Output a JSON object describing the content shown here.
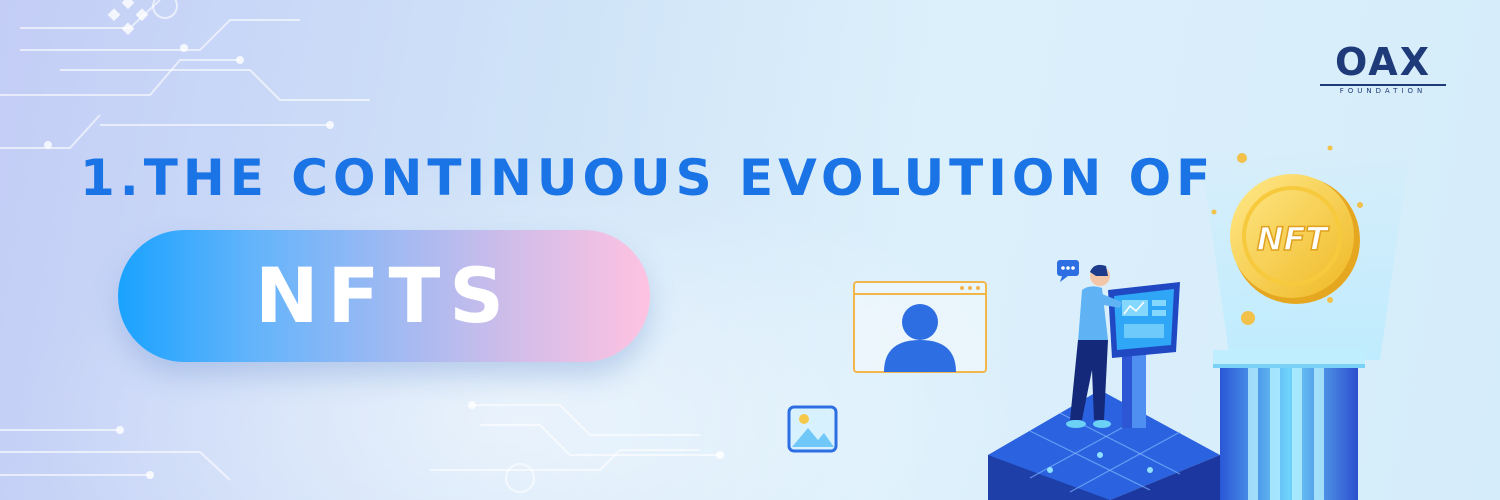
{
  "brand": {
    "logo_text": "OAX",
    "logo_subtext": "FOUNDATION"
  },
  "headline": {
    "line1": "1.THE CONTINUOUS EVOLUTION OF",
    "highlight": "NFTS"
  },
  "illustration": {
    "coin_label": "NFT",
    "icons": [
      "chat-icon",
      "image-icon",
      "user-profile-icon",
      "dashboard-kiosk-icon",
      "nft-coin-icon"
    ]
  },
  "colors": {
    "headline": "#1b74e6",
    "logo": "#1e3a78",
    "pill_start": "#1aa2ff",
    "pill_end": "#ffc2e1",
    "coin": "#f6d24a"
  }
}
